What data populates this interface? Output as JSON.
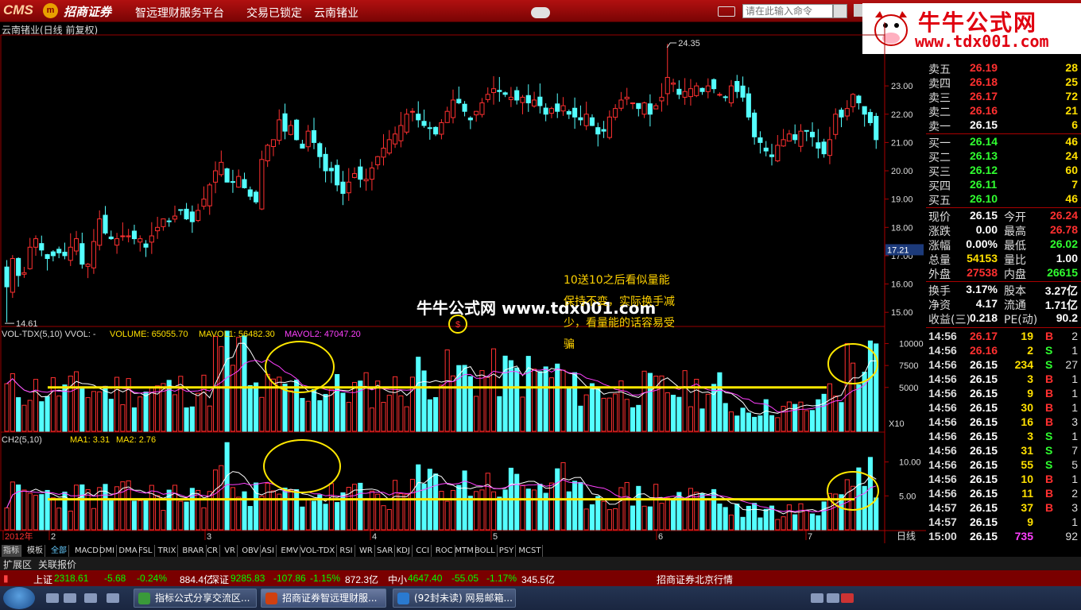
{
  "titlebar": {
    "logo": "CMS",
    "logo_badge": "m",
    "logo_name": "招商证券",
    "menu": [
      "智远理财服务平台",
      "交易已锁定",
      "云南锗业"
    ],
    "search_placeholder": "请在此输入命令"
  },
  "watermark": {
    "title": "牛牛公式网",
    "url": "www.tdx001.com"
  },
  "chart_title": "云南锗业(日线 前复权)",
  "center_watermark": "牛牛公式网  www.tdx001.com",
  "annotation": [
    "10送10之后看似量能",
    "保持不变，实际换手减",
    "少，看量能的话容易受",
    "骗"
  ],
  "chart_data": [
    {
      "type": "candlestick",
      "title": "云南锗业(日线 前复权)",
      "y_ticks": [
        "23.00",
        "22.00",
        "21.00",
        "20.00",
        "19.00",
        "18.00",
        "17.00",
        "16.00",
        "15.00"
      ],
      "ylim": [
        14.5,
        24.8
      ],
      "last_price_tag": "17.21",
      "annotations": [
        "24.35",
        "14.61"
      ],
      "closes": [
        15.9,
        16.9,
        16.3,
        16.4,
        17.3,
        17.6,
        17.2,
        16.9,
        17.0,
        17.1,
        17.0,
        17.3,
        17.6,
        16.7,
        16.7,
        17.5,
        18.3,
        17.8,
        17.6,
        17.6,
        17.7,
        17.7,
        17.6,
        17.6,
        17.3,
        17.7,
        18.0,
        18.3,
        18.2,
        18.4,
        18.6,
        18.3,
        18.2,
        18.6,
        19.0,
        19.5,
        20.0,
        20.3,
        19.6,
        19.6,
        19.8,
        19.4,
        19.1,
        18.9,
        20.4,
        20.9,
        21.1,
        21.8,
        21.4,
        21.6,
        21.1,
        20.8,
        21.4,
        21.0,
        20.5,
        20.0,
        20.0,
        19.5,
        19.2,
        19.6,
        19.9,
        19.7,
        19.7,
        20.1,
        20.5,
        20.8,
        21.1,
        21.3,
        21.6,
        22.0,
        22.1,
        21.8,
        21.6,
        21.5,
        21.3,
        21.7,
        22.1,
        22.5,
        22.4,
        22.1,
        21.8,
        22.1,
        22.4,
        22.7,
        22.9,
        22.8,
        22.7,
        22.6,
        22.5,
        22.6,
        22.4,
        22.5,
        22.3,
        22.0,
        22.2,
        22.1,
        22.3,
        22.0,
        21.9,
        21.8,
        22.0,
        21.6,
        21.3,
        21.4,
        21.9,
        22.2,
        22.5,
        22.6,
        22.4,
        22.2,
        22.4,
        22.0,
        22.3,
        22.6,
        23.3,
        23.1,
        22.7,
        22.8,
        22.9,
        23.0,
        22.8,
        23.0,
        22.9,
        22.7,
        22.6,
        23.0,
        22.8,
        22.6,
        21.9,
        21.2,
        21.0,
        20.7,
        20.5,
        20.9,
        21.1,
        21.3,
        21.1,
        21.4,
        21.4,
        21.2,
        20.8,
        20.6,
        21.1,
        22.0,
        21.9,
        22.2,
        22.7,
        22.4,
        22.0,
        21.7,
        21.1
      ],
      "vol_note": "volumes and indicator bars drawn by script"
    },
    {
      "type": "bar",
      "title": "VOL-TDX(5,10) VVOL: -",
      "legend": [
        "VOLUME: 65055.70",
        "MAVOL1: 56482.30",
        "MAVOL2: 47047.20"
      ],
      "y_ticks": [
        "10000",
        "7500",
        "5000"
      ],
      "ylim": [
        0,
        11500
      ],
      "unit_tag": "X10",
      "reference_line": 5000
    },
    {
      "type": "bar",
      "title": "CH2(5,10)",
      "legend": [
        "MA1: 3.31",
        "MA2: 2.76"
      ],
      "y_ticks": [
        "10.00",
        "5.00"
      ],
      "ylim": [
        0,
        13
      ],
      "reference_line": 4.5
    }
  ],
  "x_axis": {
    "labels": [
      "2012年",
      "2",
      "3",
      "4",
      "5",
      "6",
      "7"
    ],
    "period": "日线",
    "controls": [
      "+",
      "-",
      "0"
    ]
  },
  "orderbook": {
    "sell": [
      [
        "卖五",
        "26.19",
        "28"
      ],
      [
        "卖四",
        "26.18",
        "25"
      ],
      [
        "卖三",
        "26.17",
        "72"
      ],
      [
        "卖二",
        "26.16",
        "21"
      ],
      [
        "卖一",
        "26.15",
        "6"
      ]
    ],
    "buy": [
      [
        "买一",
        "26.14",
        "46"
      ],
      [
        "买二",
        "26.13",
        "24"
      ],
      [
        "买三",
        "26.12",
        "60"
      ],
      [
        "买四",
        "26.11",
        "7"
      ],
      [
        "买五",
        "26.10",
        "46"
      ]
    ]
  },
  "quote": [
    [
      "现价",
      "26.15",
      "今开",
      "26.24"
    ],
    [
      "涨跌",
      "0.00",
      "最高",
      "26.78"
    ],
    [
      "涨幅",
      "0.00%",
      "最低",
      "26.02"
    ],
    [
      "总量",
      "54153",
      "量比",
      "1.00"
    ],
    [
      "外盘",
      "27538",
      "内盘",
      "26615"
    ],
    [
      "换手",
      "3.17%",
      "股本",
      "3.27亿"
    ],
    [
      "净资",
      "4.17",
      "流通",
      "1.71亿"
    ],
    [
      "收益(三)",
      "0.218",
      "PE(动)",
      "90.2"
    ]
  ],
  "ticks": [
    [
      "14:56",
      "26.17",
      "19",
      "B",
      "2"
    ],
    [
      "14:56",
      "26.16",
      "2",
      "S",
      "1"
    ],
    [
      "14:56",
      "26.15",
      "234",
      "S",
      "27"
    ],
    [
      "14:56",
      "26.15",
      "3",
      "B",
      "1"
    ],
    [
      "14:56",
      "26.15",
      "9",
      "B",
      "1"
    ],
    [
      "14:56",
      "26.15",
      "30",
      "B",
      "1"
    ],
    [
      "14:56",
      "26.15",
      "16",
      "B",
      "3"
    ],
    [
      "14:56",
      "26.15",
      "3",
      "S",
      "1"
    ],
    [
      "14:56",
      "26.15",
      "31",
      "S",
      "7"
    ],
    [
      "14:56",
      "26.15",
      "55",
      "S",
      "5"
    ],
    [
      "14:56",
      "26.15",
      "10",
      "B",
      "1"
    ],
    [
      "14:56",
      "26.15",
      "11",
      "B",
      "2"
    ],
    [
      "14:57",
      "26.15",
      "37",
      "B",
      "3"
    ],
    [
      "14:57",
      "26.15",
      "9",
      "",
      "1"
    ],
    [
      "15:00",
      "26.15",
      "735",
      "",
      "92"
    ]
  ],
  "indicator_tabs": [
    "指标",
    "模板",
    "全部",
    "MACD",
    "DMI",
    "DMA",
    "FSL",
    "TRIX",
    "BRAR",
    "CR",
    "VR",
    "OBV",
    "ASI",
    "EMV",
    "VOL-TDX",
    "RSI",
    "WR",
    "SAR",
    "KDJ",
    "CCI",
    "ROC",
    "MTM",
    "BOLL",
    "PSY",
    "MCST"
  ],
  "bottom_tabs": [
    "扩展区",
    "关联报价"
  ],
  "status": {
    "sh_label": "上证",
    "sh_value": "2318.61",
    "sh_change": "-5.68",
    "sh_pct": "-0.24%",
    "sh_amount": "884.4亿",
    "sz_label": "深证",
    "sz_value": "9285.83",
    "sz_change": "-107.86",
    "sz_pct": "-1.15%",
    "sz_amount": "872.3亿",
    "zx_label": "中小",
    "zx_value": "4647.40",
    "zx_change": "-55.05",
    "zx_pct": "-1.17%",
    "zx_amount": "345.5亿",
    "broker": "招商证券北京行情"
  },
  "taskbar": {
    "tasks": [
      "指标公式分享交流区...",
      "招商证券智远理财服...",
      "(92封未读) 网易邮箱..."
    ]
  },
  "colors": {
    "up": "#ff3030",
    "down": "#54ffff",
    "ma1": "#ffffff",
    "ma2": "#ff40ff",
    "ref_line": "#ffe800",
    "circle": "#ffe800"
  }
}
